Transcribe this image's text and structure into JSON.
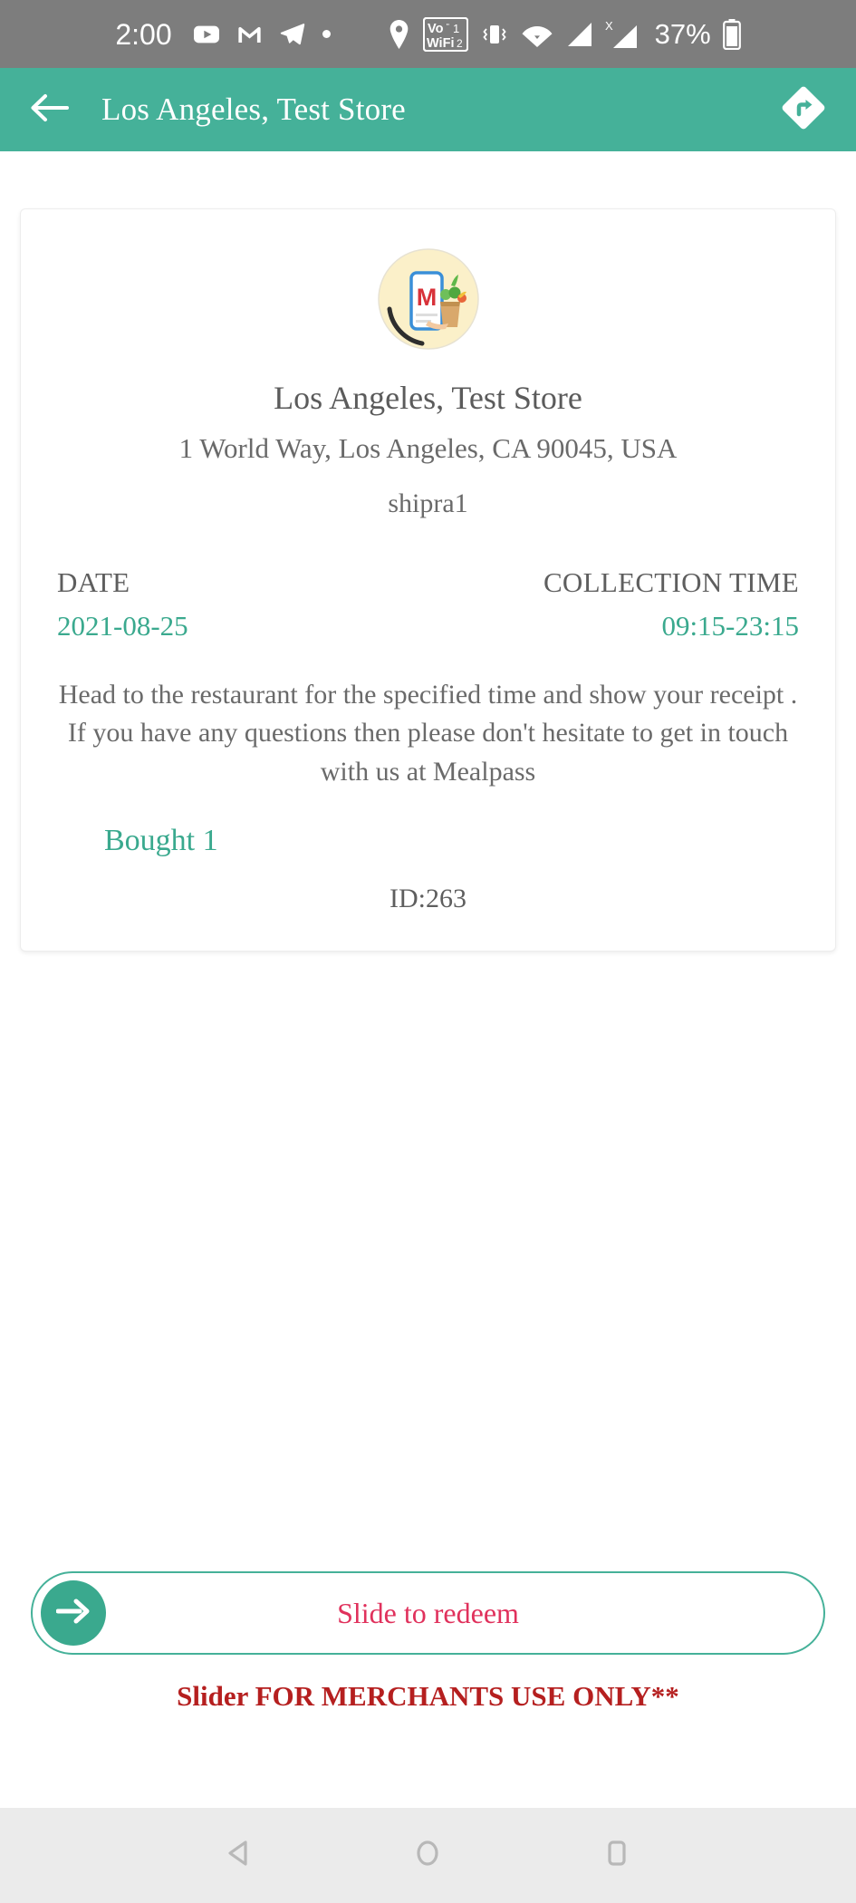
{
  "status_bar": {
    "clock": "2:00",
    "battery_percent": "37%",
    "icons": [
      "youtube-icon",
      "gmail-icon",
      "telegram-icon",
      "dot-indicator-icon",
      "location-pin-icon",
      "vowifi-icon",
      "vibrate-icon",
      "wifi-icon",
      "signal-sim1-icon",
      "signal-sim2-no-service-icon",
      "battery-icon"
    ],
    "vowifi_label_top": "Vo",
    "vowifi_label_bottom": "WiFi",
    "vowifi_sim1": "1",
    "vowifi_sim2": "2",
    "sim2_cross": "X",
    "background_color": "#7d7d7d"
  },
  "app_bar": {
    "title": "Los Angeles, Test Store",
    "back_icon": "back-arrow-icon",
    "directions_icon": "directions-icon",
    "background_color": "#45b199"
  },
  "receipt": {
    "logo_alt": "mealpass-logo",
    "store_name": "Los Angeles, Test Store",
    "address": "1 World Way, Los Angeles, CA 90045, USA",
    "username": "shipra1",
    "date_label": "DATE",
    "date_value": "2021-08-25",
    "collection_time_label": "COLLECTION TIME",
    "collection_time_value": "09:15-23:15",
    "instructions": "Head to the restaurant for the specified time and show your receipt . If you have any questions then please don't hesitate to get in touch with us at Mealpass",
    "bought_label": "Bought 1",
    "order_id": "ID:263",
    "accent_color": "#3aa98e",
    "text_color": "#6a6a6a"
  },
  "slider": {
    "label": "Slide to redeem",
    "knob_icon": "arrow-right-icon",
    "note": "Slider FOR MERCHANTS USE ONLY**",
    "label_color": "#e0315c",
    "note_color": "#b51f1f",
    "border_color": "#45b199"
  },
  "nav_bar": {
    "back_icon": "nav-back-triangle-icon",
    "home_icon": "nav-home-circle-icon",
    "recents_icon": "nav-recents-square-icon",
    "background_color": "#ebebeb"
  }
}
